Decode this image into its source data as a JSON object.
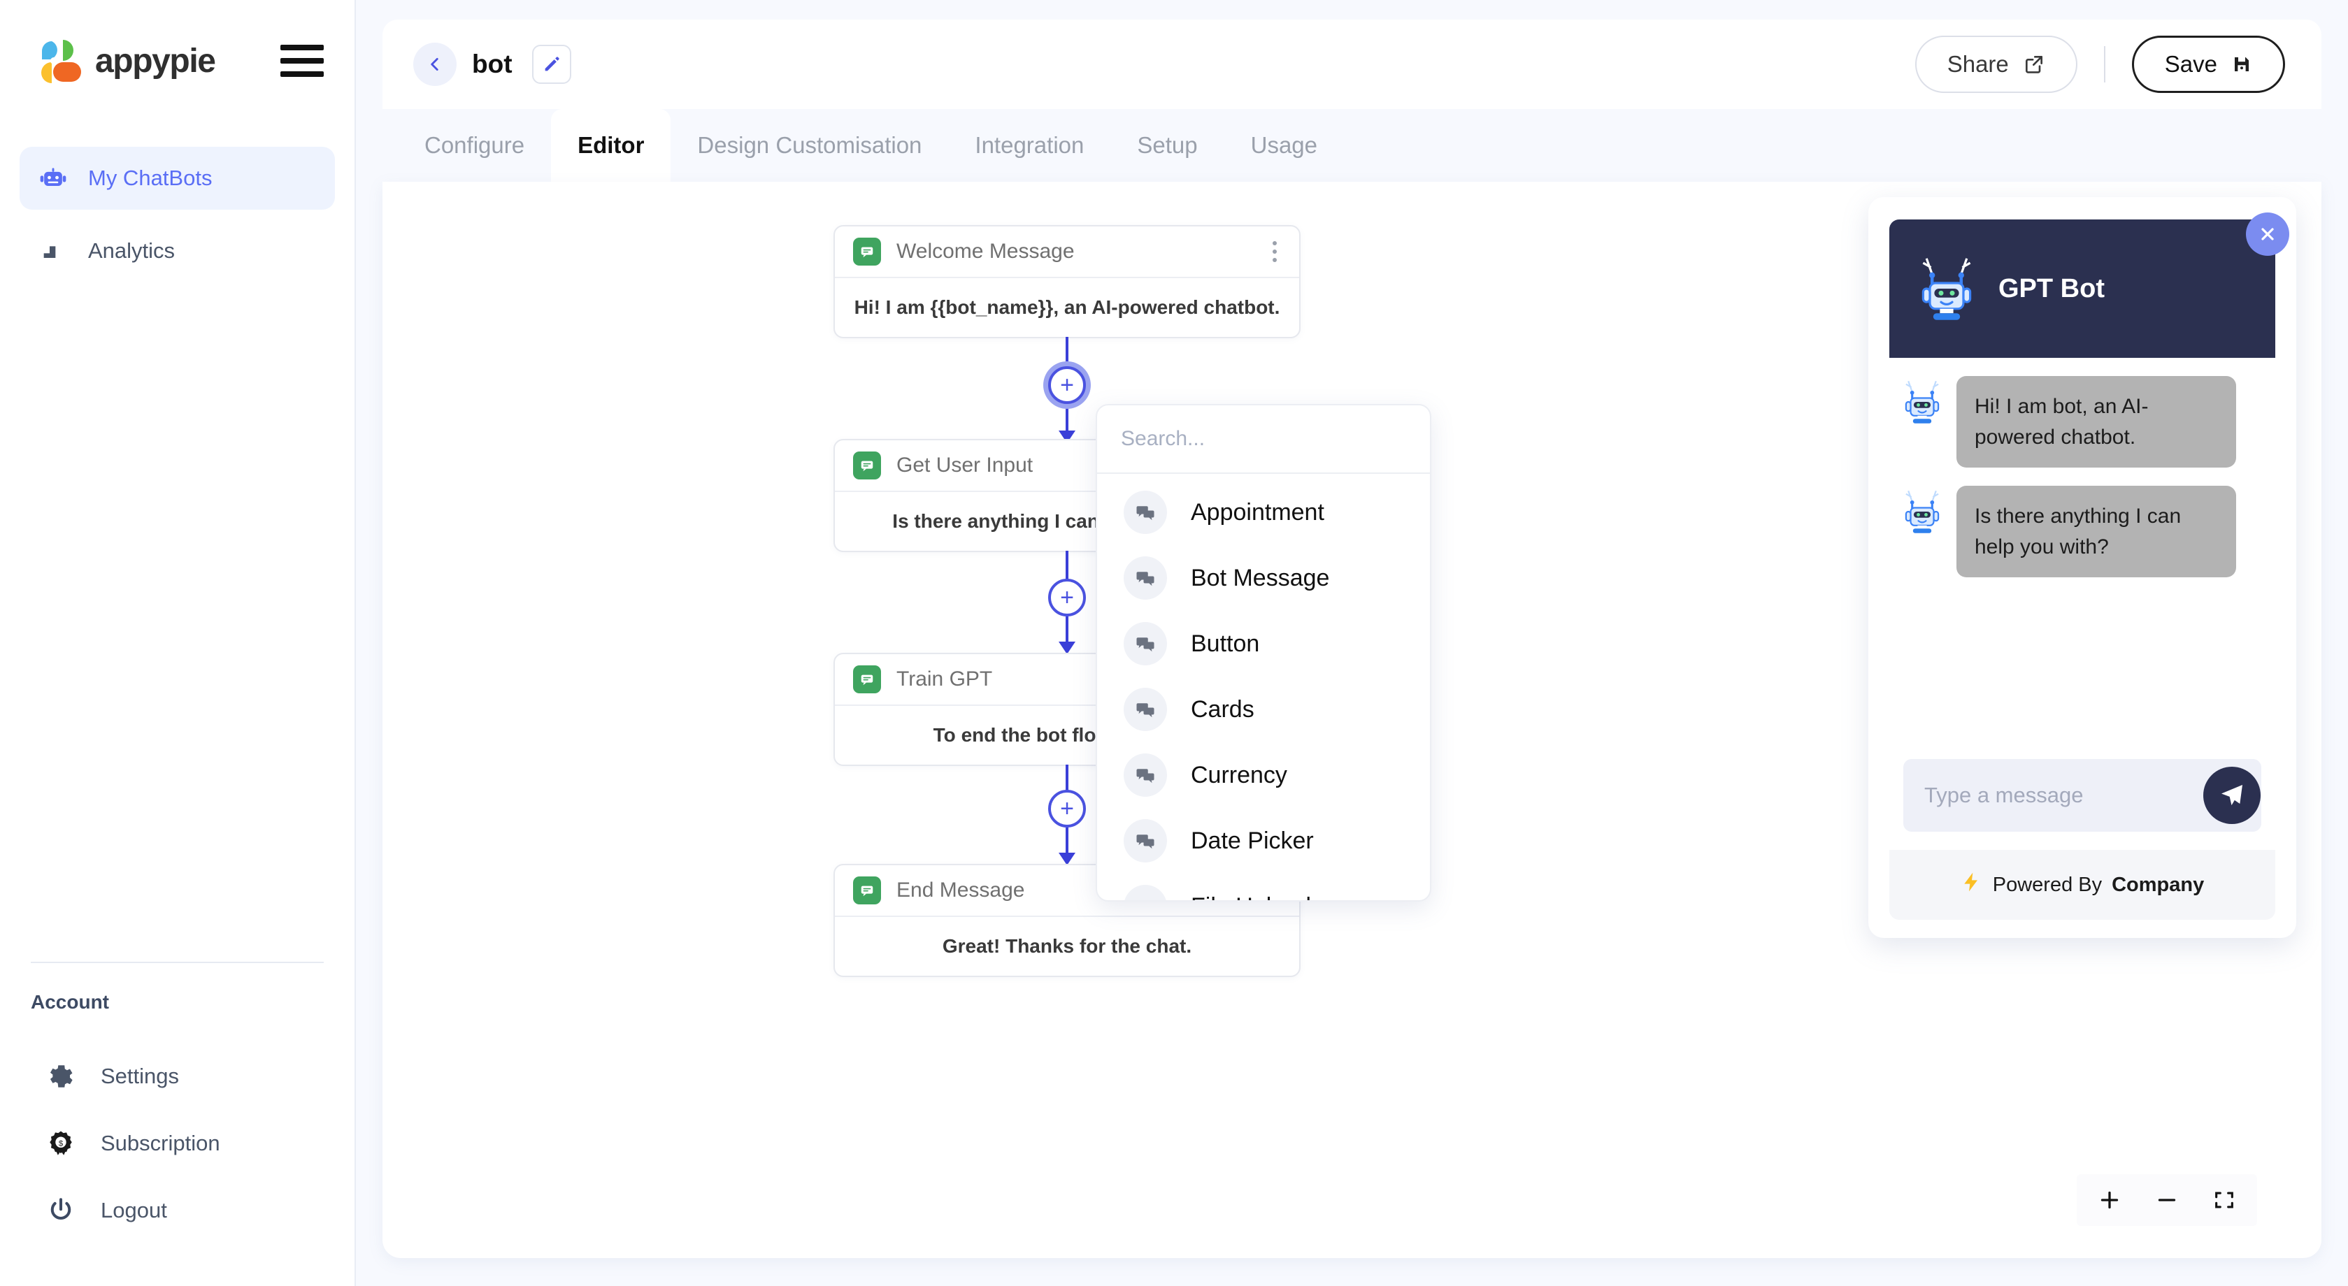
{
  "brand": {
    "name": "appypie"
  },
  "sidebar": {
    "items": [
      {
        "label": "My ChatBots",
        "icon": "robot-icon",
        "active": true
      },
      {
        "label": "Analytics",
        "icon": "bar-chart-icon",
        "active": false
      }
    ],
    "account": {
      "title": "Account",
      "items": [
        {
          "label": "Settings",
          "icon": "gear-icon"
        },
        {
          "label": "Subscription",
          "icon": "badge-dollar-icon"
        },
        {
          "label": "Logout",
          "icon": "power-icon"
        }
      ]
    }
  },
  "header": {
    "bot_name": "bot",
    "back_icon": "chevron-left-icon",
    "edit_icon": "pencil-icon",
    "share_label": "Share",
    "share_icon": "external-link-icon",
    "save_label": "Save",
    "save_icon": "floppy-disk-icon"
  },
  "tabs": [
    {
      "label": "Configure",
      "active": false
    },
    {
      "label": "Editor",
      "active": true
    },
    {
      "label": "Design Customisation",
      "active": false
    },
    {
      "label": "Integration",
      "active": false
    },
    {
      "label": "Setup",
      "active": false
    },
    {
      "label": "Usage",
      "active": false
    }
  ],
  "canvas": {
    "close_icon": "close-icon",
    "nodes": [
      {
        "title": "Welcome Message",
        "text": "Hi! I am {{bot_name}}, an AI-powered chatbot."
      },
      {
        "title": "Get User Input",
        "text": "Is there anything I can help you with?"
      },
      {
        "title": "Train GPT",
        "text": "To end the bot flow, type bye"
      },
      {
        "title": "End Message",
        "text": "Great! Thanks for the chat."
      }
    ],
    "plus_label": "+",
    "zoom_controls": [
      {
        "name": "zoom-in",
        "icon": "plus-icon"
      },
      {
        "name": "zoom-out",
        "icon": "minus-icon"
      },
      {
        "name": "fit-screen",
        "icon": "fit-screen-icon"
      }
    ]
  },
  "dropdown": {
    "search_placeholder": "Search...",
    "search_value": "",
    "items": [
      {
        "label": "Appointment",
        "icon": "chat-bubbles-icon"
      },
      {
        "label": "Bot Message",
        "icon": "chat-bubbles-icon"
      },
      {
        "label": "Button",
        "icon": "chat-bubbles-icon"
      },
      {
        "label": "Cards",
        "icon": "chat-bubbles-icon"
      },
      {
        "label": "Currency",
        "icon": "chat-bubbles-icon"
      },
      {
        "label": "Date Picker",
        "icon": "chat-bubbles-icon"
      },
      {
        "label": "File Upload",
        "icon": "chat-bubbles-icon"
      }
    ]
  },
  "chat_preview": {
    "title": "GPT Bot",
    "avatar_icon": "robot-avatar-icon",
    "messages": [
      {
        "from": "bot",
        "text": "Hi! I am bot, an AI-powered chatbot."
      },
      {
        "from": "bot",
        "text": "Is there anything I can help you with?"
      }
    ],
    "input_placeholder": "Type a message",
    "input_value": "",
    "send_icon": "paper-plane-icon",
    "footer_prefix": "Powered By",
    "footer_brand": "Company",
    "footer_icon": "lightning-bolt-icon"
  },
  "colors": {
    "accent": "#5a6ef5",
    "flow_line": "#3a3fd8",
    "node_badge": "#3fa45f",
    "chat_header": "#2b3050",
    "canvas_bg": "#ffffff",
    "page_bg": "#f7f9fe"
  }
}
